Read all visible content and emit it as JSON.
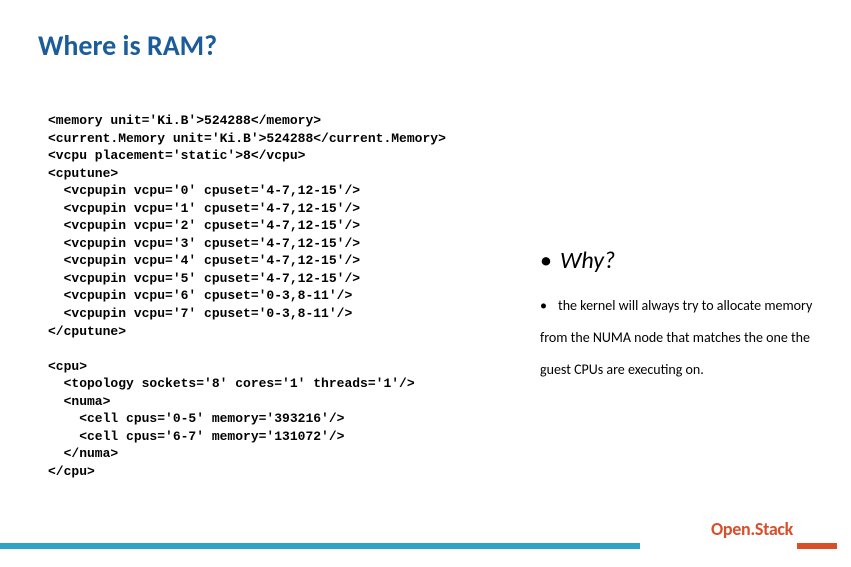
{
  "title": "Where is RAM?",
  "code": "<memory unit='Ki.B'>524288</memory>\n<current.Memory unit='Ki.B'>524288</current.Memory>\n<vcpu placement='static'>8</vcpu>\n<cputune>\n  <vcpupin vcpu='0' cpuset='4-7,12-15'/>\n  <vcpupin vcpu='1' cpuset='4-7,12-15'/>\n  <vcpupin vcpu='2' cpuset='4-7,12-15'/>\n  <vcpupin vcpu='3' cpuset='4-7,12-15'/>\n  <vcpupin vcpu='4' cpuset='4-7,12-15'/>\n  <vcpupin vcpu='5' cpuset='4-7,12-15'/>\n  <vcpupin vcpu='6' cpuset='0-3,8-11'/>\n  <vcpupin vcpu='7' cpuset='0-3,8-11'/>\n</cputune>\n\n<cpu>\n  <topology sockets='8' cores='1' threads='1'/>\n  <numa>\n    <cell cpus='0-5' memory='393216'/>\n    <cell cpus='6-7' memory='131072'/>\n  </numa>\n</cpu>",
  "why_label": "Why?",
  "explanation": "the kernel will always try to allocate memory from the NUMA node that matches the one the guest CPUs are executing on.",
  "logo": "Open.Stack"
}
